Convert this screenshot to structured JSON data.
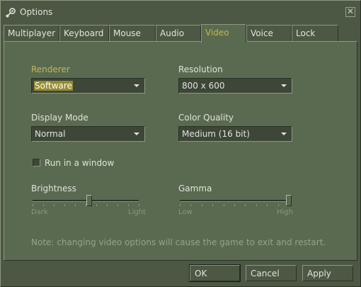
{
  "window": {
    "title": "Options",
    "close_glyph": "✕"
  },
  "tabs": [
    {
      "label": "Multiplayer"
    },
    {
      "label": "Keyboard"
    },
    {
      "label": "Mouse"
    },
    {
      "label": "Audio"
    },
    {
      "label": "Video",
      "active": true
    },
    {
      "label": "Voice"
    },
    {
      "label": "Lock"
    }
  ],
  "video": {
    "renderer": {
      "label": "Renderer",
      "value": "Software"
    },
    "resolution": {
      "label": "Resolution",
      "value": "800 x 600"
    },
    "display_mode": {
      "label": "Display Mode",
      "value": "Normal"
    },
    "color_quality": {
      "label": "Color Quality",
      "value": "Medium (16 bit)"
    },
    "run_in_window": {
      "label": "Run in a window",
      "checked": false
    },
    "brightness": {
      "label": "Brightness",
      "min_label": "Dark",
      "max_label": "Light",
      "level": 0.53
    },
    "gamma": {
      "label": "Gamma",
      "min_label": "Low",
      "max_label": "High",
      "level": 1.0
    },
    "note": "Note: changing video options will cause the game to exit and restart."
  },
  "buttons": {
    "ok": "OK",
    "cancel": "Cancel",
    "apply": "Apply"
  },
  "colors": {
    "background": "#4c5844",
    "panel": "#5a6a50",
    "accent": "#c4b550",
    "selection": "#958c30"
  },
  "icons": {
    "title": "steam-logo-icon",
    "close": "close-icon",
    "dropdown": "chevron-down-icon"
  }
}
